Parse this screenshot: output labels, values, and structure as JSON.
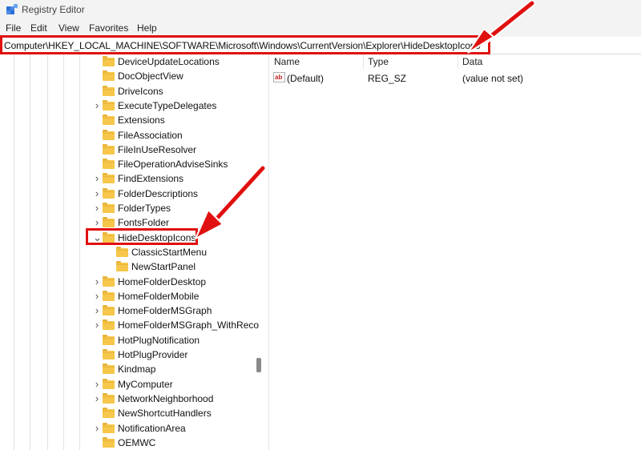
{
  "window": {
    "title": "Registry Editor"
  },
  "menu": [
    "File",
    "Edit",
    "View",
    "Favorites",
    "Help"
  ],
  "address": {
    "path": "Computer\\HKEY_LOCAL_MACHINE\\SOFTWARE\\Microsoft\\Windows\\CurrentVersion\\Explorer\\HideDesktopIcons"
  },
  "tree": {
    "items": [
      {
        "label": "DeviceUpdateLocations",
        "expander": ""
      },
      {
        "label": "DocObjectView",
        "expander": ""
      },
      {
        "label": "DriveIcons",
        "expander": ""
      },
      {
        "label": "ExecuteTypeDelegates",
        "expander": ">"
      },
      {
        "label": "Extensions",
        "expander": ""
      },
      {
        "label": "FileAssociation",
        "expander": ""
      },
      {
        "label": "FileInUseResolver",
        "expander": ""
      },
      {
        "label": "FileOperationAdviseSinks",
        "expander": ""
      },
      {
        "label": "FindExtensions",
        "expander": ">"
      },
      {
        "label": "FolderDescriptions",
        "expander": ">"
      },
      {
        "label": "FolderTypes",
        "expander": ">"
      },
      {
        "label": "FontsFolder",
        "expander": ">"
      },
      {
        "label": "HideDesktopIcons",
        "expander": "v"
      },
      {
        "label": "ClassicStartMenu",
        "expander": ""
      },
      {
        "label": "NewStartPanel",
        "expander": ""
      },
      {
        "label": "HomeFolderDesktop",
        "expander": ">"
      },
      {
        "label": "HomeFolderMobile",
        "expander": ">"
      },
      {
        "label": "HomeFolderMSGraph",
        "expander": ">"
      },
      {
        "label": "HomeFolderMSGraph_WithReco",
        "expander": ">"
      },
      {
        "label": "HotPlugNotification",
        "expander": ""
      },
      {
        "label": "HotPlugProvider",
        "expander": ""
      },
      {
        "label": "Kindmap",
        "expander": ""
      },
      {
        "label": "MyComputer",
        "expander": ">"
      },
      {
        "label": "NetworkNeighborhood",
        "expander": ">"
      },
      {
        "label": "NewShortcutHandlers",
        "expander": ""
      },
      {
        "label": "NotificationArea",
        "expander": ">"
      },
      {
        "label": "OEMWC",
        "expander": ""
      }
    ]
  },
  "list": {
    "headers": {
      "name": "Name",
      "type": "Type",
      "data": "Data"
    },
    "rows": [
      {
        "name": "(Default)",
        "type": "REG_SZ",
        "data": "(value not set)",
        "icon": "ab"
      }
    ]
  },
  "colors": {
    "highlight": "#e01010",
    "folder": "#f6c74a",
    "chrome": "#f3f3f3"
  }
}
